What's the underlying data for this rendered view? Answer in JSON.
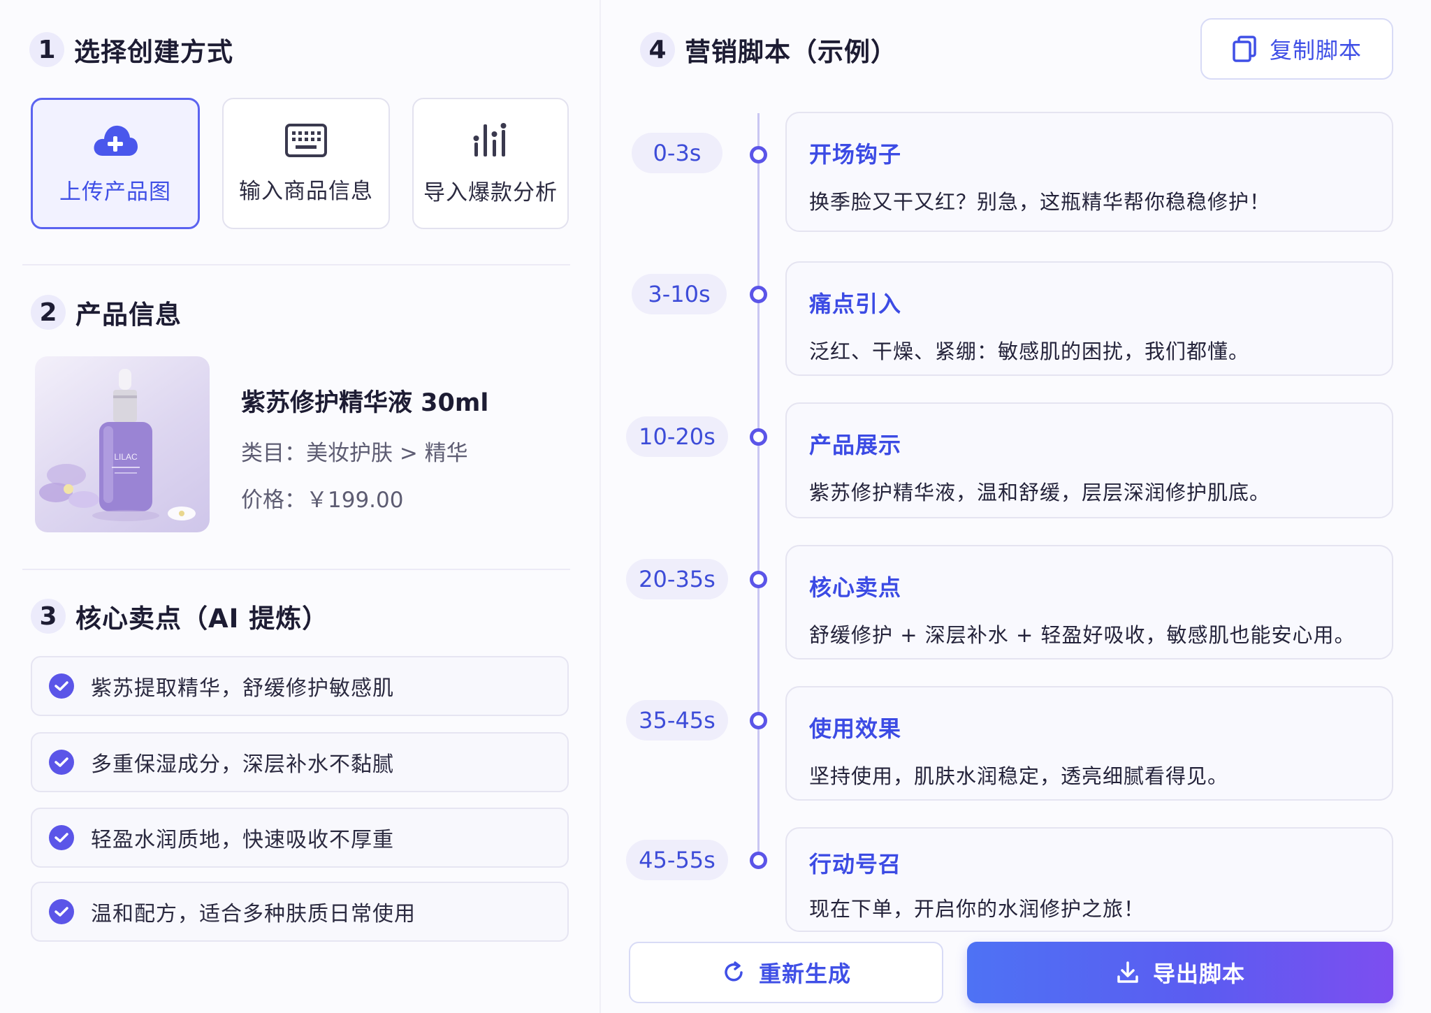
{
  "section1": {
    "number": "1",
    "title": "选择创建方式",
    "methods": [
      {
        "label": "上传产品图",
        "icon": "cloud-upload-icon",
        "active": true
      },
      {
        "label": "输入商品信息",
        "icon": "keyboard-icon",
        "active": false
      },
      {
        "label": "导入爆款分析",
        "icon": "chart-bars-icon",
        "active": false
      }
    ]
  },
  "section2": {
    "number": "2",
    "title": "产品信息",
    "product": {
      "name": "紫苏修护精华液 30ml",
      "category_label": "类目：",
      "category": "美妆护肤 > 精华",
      "price_label": "价格：",
      "price": "￥199.00",
      "bottle_text": "LILAC"
    }
  },
  "section3": {
    "number": "3",
    "title": "核心卖点（AI 提炼）",
    "features": [
      "紫苏提取精华，舒缓修护敏感肌",
      "多重保湿成分，深层补水不黏腻",
      "轻盈水润质地，快速吸收不厚重",
      "温和配方，适合多种肤质日常使用"
    ]
  },
  "section4": {
    "number": "4",
    "title": "营销脚本（示例）",
    "copy_button": "复制脚本",
    "steps": [
      {
        "time": "0-3s",
        "title": "开场钩子",
        "text": "换季脸又干又红？别急，这瓶精华帮你稳稳修护！"
      },
      {
        "time": "3-10s",
        "title": "痛点引入",
        "text": "泛红、干燥、紧绷：敏感肌的困扰，我们都懂。"
      },
      {
        "time": "10-20s",
        "title": "产品展示",
        "text": "紫苏修护精华液，温和舒缓，层层深润修护肌底。"
      },
      {
        "time": "20-35s",
        "title": "核心卖点",
        "text": "舒缓修护 + 深层补水 + 轻盈好吸收，敏感肌也能安心用。"
      },
      {
        "time": "35-45s",
        "title": "使用效果",
        "text": "坚持使用，肌肤水润稳定，透亮细腻看得见。"
      },
      {
        "time": "45-55s",
        "title": "行动号召",
        "text": "现在下单，开启你的水润修护之旅！"
      }
    ],
    "regenerate_button": "重新生成",
    "export_button": "导出脚本"
  },
  "colors": {
    "accent": "#5b55e8",
    "accent_text": "#3f4fe6",
    "export_gradient_start": "#4e72f4",
    "export_gradient_end": "#7d4ef0"
  }
}
